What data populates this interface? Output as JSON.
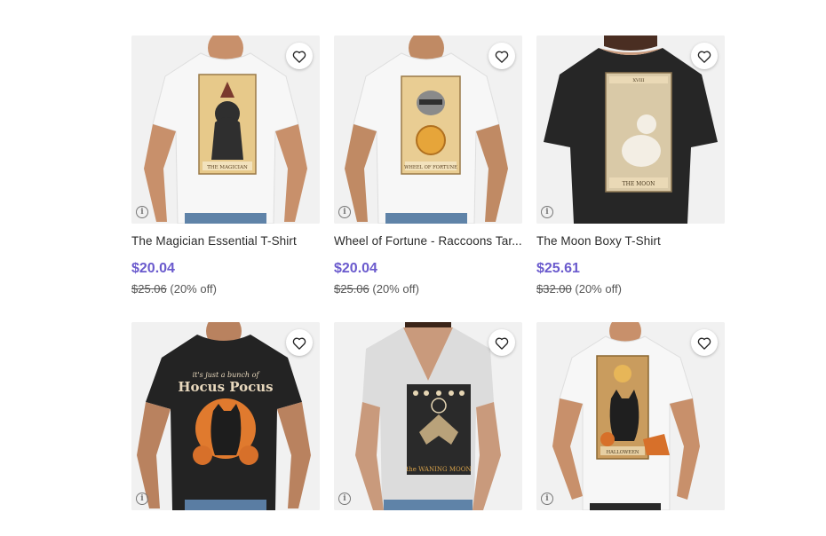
{
  "products": [
    {
      "title": "The Magician Essential T-Shirt",
      "price": "$20.04",
      "original_price": "$25.06",
      "discount": "(20% off)",
      "shirt_color": "#f4f4f4",
      "print_bg": "#e7c98a",
      "print_label": "THE MAGICIAN",
      "model": "man"
    },
    {
      "title": "Wheel of Fortune - Raccoons Tarot Essential T-Shirt",
      "title_display": "Wheel of Fortune - Raccoons Tar...",
      "price": "$20.04",
      "original_price": "$25.06",
      "discount": "(20% off)",
      "shirt_color": "#f4f4f4",
      "print_bg": "#e9cd93",
      "print_label": "WHEEL OF FORTUNE",
      "model": "man"
    },
    {
      "title": "The Moon Boxy T-Shirt",
      "price": "$25.61",
      "original_price": "$32.00",
      "discount": "(20% off)",
      "shirt_color": "#222222",
      "print_bg": "#d9c9a7",
      "print_label": "THE MOON",
      "numeral": "XVIII",
      "model": "woman"
    },
    {
      "title": "",
      "price": "",
      "original_price": "",
      "discount": "",
      "shirt_color": "#222222",
      "print_bg": "#222222",
      "print_label": "Hocus Pocus",
      "print_tagline": "it's just a bunch of",
      "model": "man"
    },
    {
      "title": "",
      "price": "",
      "original_price": "",
      "discount": "",
      "shirt_color": "#dcdcdc",
      "print_bg": "#2a2a2a",
      "print_label": "the WANING MOON",
      "model": "woman"
    },
    {
      "title": "",
      "price": "",
      "original_price": "",
      "discount": "",
      "shirt_color": "#f4f4f4",
      "print_bg": "#c99c5e",
      "print_label": "HALLOWEEN",
      "model": "man"
    }
  ],
  "icons": {
    "favorite": "heart-outline-icon",
    "info": "info-circle-icon"
  },
  "colors": {
    "price": "#6a5acd",
    "text": "#2b2b2b",
    "muted": "#555555"
  },
  "info_glyph": "i"
}
